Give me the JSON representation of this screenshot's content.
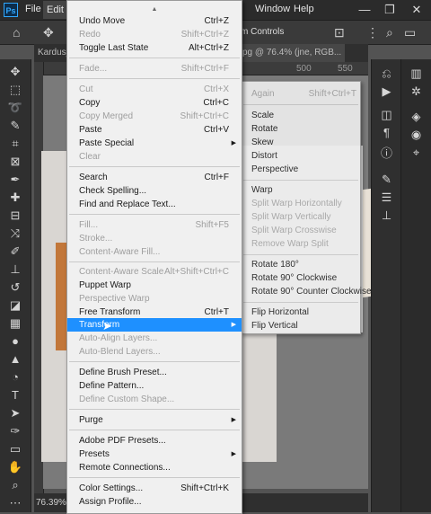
{
  "menubar": {
    "logo": "Ps",
    "file": "File",
    "edit": "Edit",
    "window": "Window",
    "help": "Help",
    "minimize": "—",
    "restore": "❐",
    "close": "✕"
  },
  "options_bar": {
    "partial_label": "m Controls"
  },
  "tabs": {
    "tab1": "Kardus_",
    "tab2": "pg @ 76.4% (jne, RGB..."
  },
  "ruler": {
    "n500": "500",
    "n550": "550"
  },
  "status": {
    "zoom": "76.39%"
  },
  "edit_menu": {
    "arrow_up": "▲",
    "undo_move": {
      "label": "Undo Move",
      "shortcut": "Ctrl+Z"
    },
    "redo": {
      "label": "Redo",
      "shortcut": "Shift+Ctrl+Z"
    },
    "toggle_last_state": {
      "label": "Toggle Last State",
      "shortcut": "Alt+Ctrl+Z"
    },
    "fade": {
      "label": "Fade...",
      "shortcut": "Shift+Ctrl+F"
    },
    "cut": {
      "label": "Cut",
      "shortcut": "Ctrl+X"
    },
    "copy": {
      "label": "Copy",
      "shortcut": "Ctrl+C"
    },
    "copy_merged": {
      "label": "Copy Merged",
      "shortcut": "Shift+Ctrl+C"
    },
    "paste": {
      "label": "Paste",
      "shortcut": "Ctrl+V"
    },
    "paste_special": {
      "label": "Paste Special"
    },
    "clear": {
      "label": "Clear"
    },
    "search": {
      "label": "Search",
      "shortcut": "Ctrl+F"
    },
    "check_spelling": {
      "label": "Check Spelling..."
    },
    "find_replace": {
      "label": "Find and Replace Text..."
    },
    "fill": {
      "label": "Fill...",
      "shortcut": "Shift+F5"
    },
    "stroke": {
      "label": "Stroke..."
    },
    "content_aware_fill": {
      "label": "Content-Aware Fill..."
    },
    "content_aware_scale": {
      "label": "Content-Aware Scale",
      "shortcut": "Alt+Shift+Ctrl+C"
    },
    "puppet_warp": {
      "label": "Puppet Warp"
    },
    "perspective_warp": {
      "label": "Perspective Warp"
    },
    "free_transform": {
      "label": "Free Transform",
      "shortcut": "Ctrl+T"
    },
    "transform": {
      "label": "Transform"
    },
    "auto_align": {
      "label": "Auto-Align Layers..."
    },
    "auto_blend": {
      "label": "Auto-Blend Layers..."
    },
    "define_brush": {
      "label": "Define Brush Preset..."
    },
    "define_pattern": {
      "label": "Define Pattern..."
    },
    "define_custom_shape": {
      "label": "Define Custom Shape..."
    },
    "purge": {
      "label": "Purge"
    },
    "pdf_presets": {
      "label": "Adobe PDF Presets..."
    },
    "presets": {
      "label": "Presets"
    },
    "remote_connections": {
      "label": "Remote Connections..."
    },
    "color_settings": {
      "label": "Color Settings...",
      "shortcut": "Shift+Ctrl+K"
    },
    "assign_profile": {
      "label": "Assign Profile..."
    }
  },
  "transform_submenu": {
    "again": {
      "label": "Again",
      "shortcut": "Shift+Ctrl+T"
    },
    "scale": "Scale",
    "rotate": "Rotate",
    "skew": "Skew",
    "distort": "Distort",
    "perspective": "Perspective",
    "warp": "Warp",
    "split_warp_h": "Split Warp Horizontally",
    "split_warp_v": "Split Warp Vertically",
    "split_warp_c": "Split Warp Crosswise",
    "remove_warp_split": "Remove Warp Split",
    "rotate_180": "Rotate 180°",
    "rotate_90_cw": "Rotate 90° Clockwise",
    "rotate_90_ccw": "Rotate 90° Counter Clockwise",
    "flip_h": "Flip Horizontal",
    "flip_v": "Flip Vertical"
  }
}
